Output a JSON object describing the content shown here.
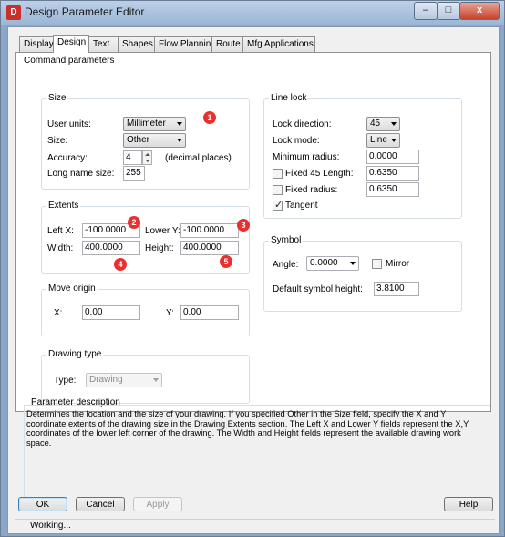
{
  "window": {
    "title": "Design Parameter Editor",
    "min": "–",
    "max": "□",
    "close": "x"
  },
  "tabs": [
    "Display",
    "Design",
    "Text",
    "Shapes",
    "Flow Planning",
    "Route",
    "Mfg Applications"
  ],
  "active_tab": "Design",
  "command_parameters": {
    "label": "Command parameters",
    "size": {
      "label": "Size",
      "user_units_label": "User units:",
      "user_units_value": "Millimeter",
      "size_label": "Size:",
      "size_value": "Other",
      "accuracy_label": "Accuracy:",
      "accuracy_value": "4",
      "accuracy_hint": "(decimal places)",
      "long_name_label": "Long name size:",
      "long_name_value": "255"
    },
    "extents": {
      "label": "Extents",
      "left_x_label": "Left X:",
      "left_x_value": "-100.0000",
      "lower_y_label": "Lower Y:",
      "lower_y_value": "-100.0000",
      "width_label": "Width:",
      "width_value": "400.0000",
      "height_label": "Height:",
      "height_value": "400.0000"
    },
    "move_origin": {
      "label": "Move origin",
      "x_label": "X:",
      "x_value": "0.00",
      "y_label": "Y:",
      "y_value": "0.00"
    },
    "drawing_type": {
      "label": "Drawing type",
      "type_label": "Type:",
      "type_value": "Drawing"
    },
    "line_lock": {
      "label": "Line lock",
      "lock_direction_label": "Lock direction:",
      "lock_direction_value": "45",
      "lock_mode_label": "Lock mode:",
      "lock_mode_value": "Line",
      "min_radius_label": "Minimum radius:",
      "min_radius_value": "0.0000",
      "fixed45_label": "Fixed 45 Length:",
      "fixed45_value": "0.6350",
      "fixed45_checked": false,
      "fixed_radius_label": "Fixed radius:",
      "fixed_radius_value": "0.6350",
      "fixed_radius_checked": false,
      "tangent_label": "Tangent",
      "tangent_checked": true
    },
    "symbol": {
      "label": "Symbol",
      "angle_label": "Angle:",
      "angle_value": "0.0000",
      "mirror_label": "Mirror",
      "mirror_checked": false,
      "default_height_label": "Default symbol height:",
      "default_height_value": "3.8100"
    }
  },
  "annotations": [
    "1",
    "2",
    "3",
    "4",
    "5"
  ],
  "description": {
    "label": "Parameter description",
    "text": "Determines the location and the size of your drawing. If you specified Other in the Size field, specify the X and Y coordinate extents of the drawing size in the Drawing Extents section. The Left X and Lower Y fields represent the X,Y coordinates of the lower left corner of the drawing. The Width and Height fields represent the available drawing work space."
  },
  "buttons": {
    "ok": "OK",
    "cancel": "Cancel",
    "apply": "Apply",
    "help": "Help"
  },
  "status": "Working...",
  "colors": {
    "badge": "#e8302e",
    "title_bar": "#9bb6d6"
  }
}
